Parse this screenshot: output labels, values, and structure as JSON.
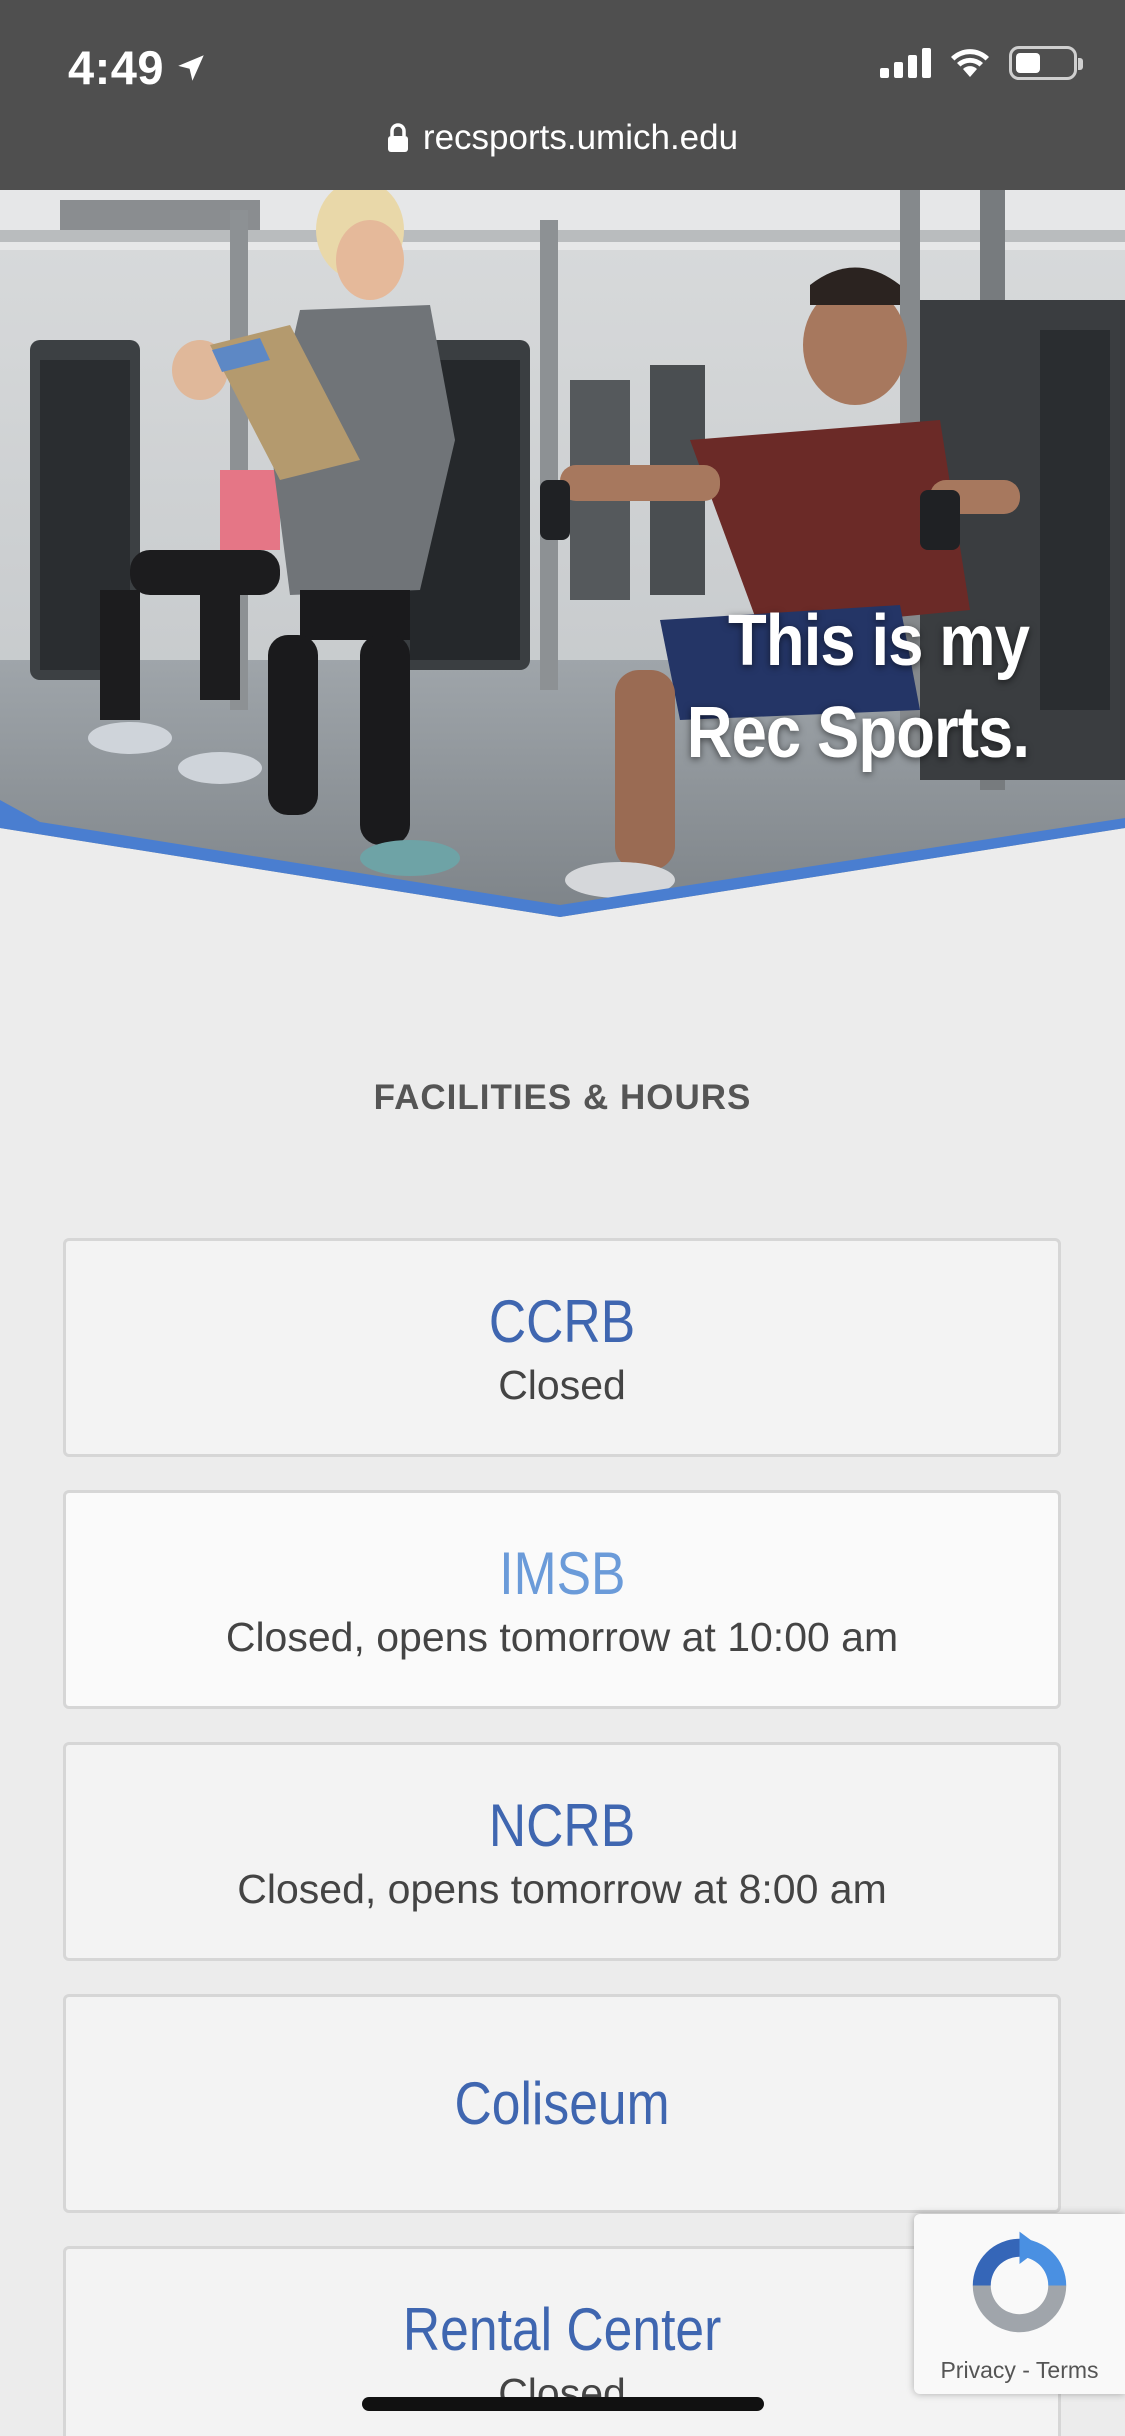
{
  "status_bar": {
    "time": "4:49",
    "icons": [
      "location-arrow-icon",
      "cellular-signal-icon",
      "wifi-icon",
      "battery-icon"
    ],
    "battery_level_percent": 45
  },
  "browser": {
    "url": "recsports.umich.edu"
  },
  "hero": {
    "line1": "This is my",
    "line2": "Rec Sports.",
    "accent_color": "#4a7ed0"
  },
  "section": {
    "title": "FACILITIES & HOURS"
  },
  "facilities": [
    {
      "name": "CCRB",
      "status": "Closed"
    },
    {
      "name": "IMSB",
      "status": "Closed, opens tomorrow at 10:00 am"
    },
    {
      "name": "NCRB",
      "status": "Closed, opens tomorrow at 8:00 am"
    },
    {
      "name": "Coliseum",
      "status": ""
    },
    {
      "name": "Rental Center",
      "status": "Closed"
    }
  ],
  "recaptcha": {
    "privacy": "Privacy",
    "separator": "-",
    "terms": "Terms"
  },
  "colors": {
    "link_blue": "#3f66b0",
    "link_blue_light": "#6b9bd9",
    "page_bg": "#ececec",
    "browser_bar": "#4f4f4f"
  }
}
